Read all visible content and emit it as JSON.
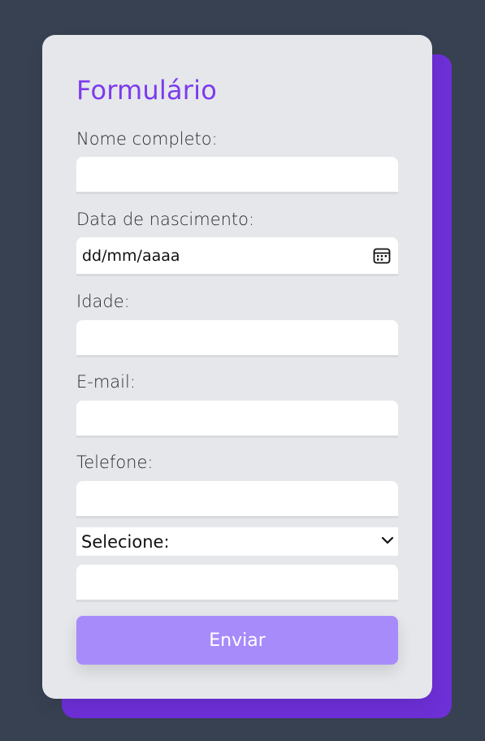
{
  "form": {
    "title": "Formulário",
    "fields": {
      "name_label": "Nome completo:",
      "name_value": "",
      "birth_label": "Data de nascimento:",
      "birth_placeholder": "dd/mm/aaaa",
      "age_label": "Idade:",
      "age_value": "",
      "email_label": "E-mail:",
      "email_value": "",
      "phone_label": "Telefone:",
      "phone_value": "",
      "select_value": "Selecione:",
      "extra_value": ""
    },
    "submit_label": "Enviar"
  },
  "colors": {
    "background": "#374151",
    "card": "#e5e7eb",
    "accent": "#7c3aed",
    "accent_back": "#6d2fd6",
    "button": "#a78bfa"
  },
  "icons": {
    "calendar": "calendar-icon",
    "chevron": "chevron-down-icon"
  }
}
